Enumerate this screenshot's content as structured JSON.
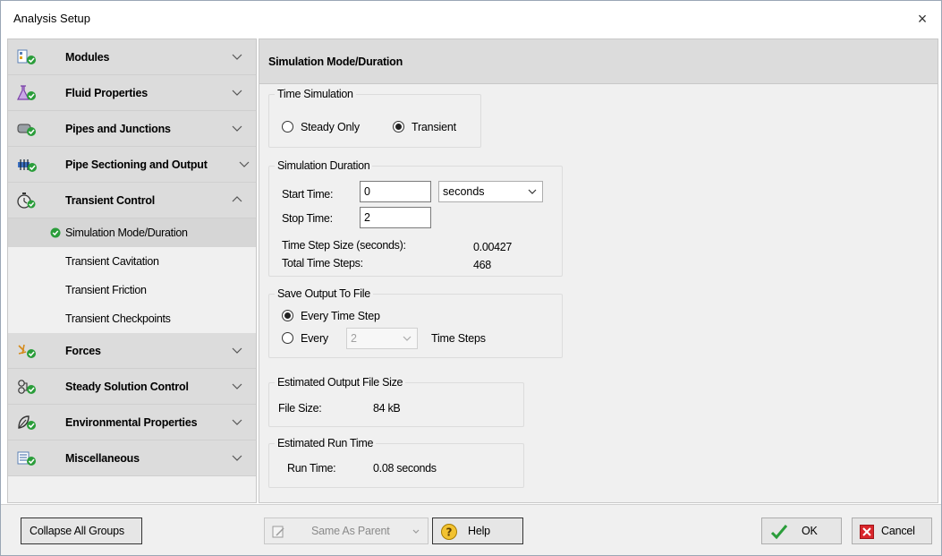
{
  "window": {
    "title": "Analysis Setup",
    "close_glyph": "×"
  },
  "sidebar": {
    "groups": [
      {
        "label": "Modules",
        "icon": "modules-icon",
        "expanded": false
      },
      {
        "label": "Fluid Properties",
        "icon": "flask-icon",
        "expanded": false
      },
      {
        "label": "Pipes and Junctions",
        "icon": "pipe-icon",
        "expanded": false
      },
      {
        "label": "Pipe Sectioning and Output",
        "icon": "pipe-sectioning-icon",
        "expanded": false
      },
      {
        "label": "Transient Control",
        "icon": "stopwatch-icon",
        "expanded": true
      },
      {
        "label": "Forces",
        "icon": "forces-icon",
        "expanded": false
      },
      {
        "label": "Steady Solution Control",
        "icon": "solution-control-icon",
        "expanded": false
      },
      {
        "label": "Environmental Properties",
        "icon": "leaf-icon",
        "expanded": false
      },
      {
        "label": "Miscellaneous",
        "icon": "miscellaneous-icon",
        "expanded": false
      }
    ],
    "transient_items": [
      {
        "label": "Simulation Mode/Duration",
        "active": true
      },
      {
        "label": "Transient Cavitation",
        "active": false
      },
      {
        "label": "Transient Friction",
        "active": false
      },
      {
        "label": "Transient Checkpoints",
        "active": false
      }
    ]
  },
  "main": {
    "title": "Simulation Mode/Duration",
    "time_simulation": {
      "legend": "Time Simulation",
      "steady_label": "Steady Only",
      "transient_label": "Transient",
      "selected": "Transient"
    },
    "duration": {
      "legend": "Simulation Duration",
      "start_label": "Start Time:",
      "start_value": "0",
      "units": "seconds",
      "stop_label": "Stop Time:",
      "stop_value": "2",
      "step_size_label": "Time Step Size (seconds):",
      "step_size_value": "0.00427",
      "total_steps_label": "Total Time Steps:",
      "total_steps_value": "468"
    },
    "save_output": {
      "legend": "Save Output To File",
      "every_step_label": "Every Time Step",
      "every_label": "Every",
      "every_value": "2",
      "time_steps_label": "Time Steps",
      "selected": "Every Time Step"
    },
    "file_size": {
      "legend": "Estimated Output File Size",
      "label": "File Size:",
      "value": "84 kB"
    },
    "run_time": {
      "legend": "Estimated Run Time",
      "label": "Run Time:",
      "value": "0.08 seconds"
    }
  },
  "footer": {
    "collapse_label": "Collapse All Groups",
    "same_as_parent_label": "Same As Parent",
    "help_label": "Help",
    "ok_label": "OK",
    "cancel_label": "Cancel"
  },
  "colors": {
    "check_green": "#2a9d3a",
    "cancel_red": "#d9262b",
    "help_yellow": "#f2c230",
    "group_bg": "#dcdcdc",
    "active_item_bg": "#d6d6d6"
  }
}
